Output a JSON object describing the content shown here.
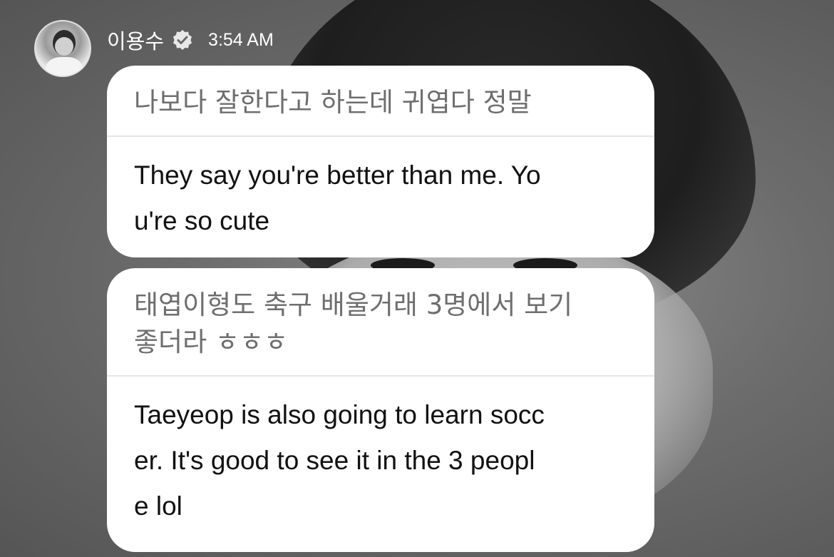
{
  "header": {
    "username": "이용수",
    "timestamp": "3:54 AM",
    "verified_icon": "verified-badge-icon"
  },
  "messages": [
    {
      "original": "나보다 잘한다고 하는데 귀엽다 정말",
      "translation": "They say you're better than me. Yo\nu're so cute"
    },
    {
      "original": "태엽이형도 축구 배울거래 3명에서 보기\n좋더라 ㅎㅎㅎ",
      "translation": "Taeyeop is also going to learn socc\ner. It's good to see it in the 3 peopl\ne lol"
    }
  ],
  "colors": {
    "bubble_background": "#ffffff",
    "original_text": "#6e6e6e",
    "translation_text": "#111111",
    "header_text": "#ffffff"
  }
}
